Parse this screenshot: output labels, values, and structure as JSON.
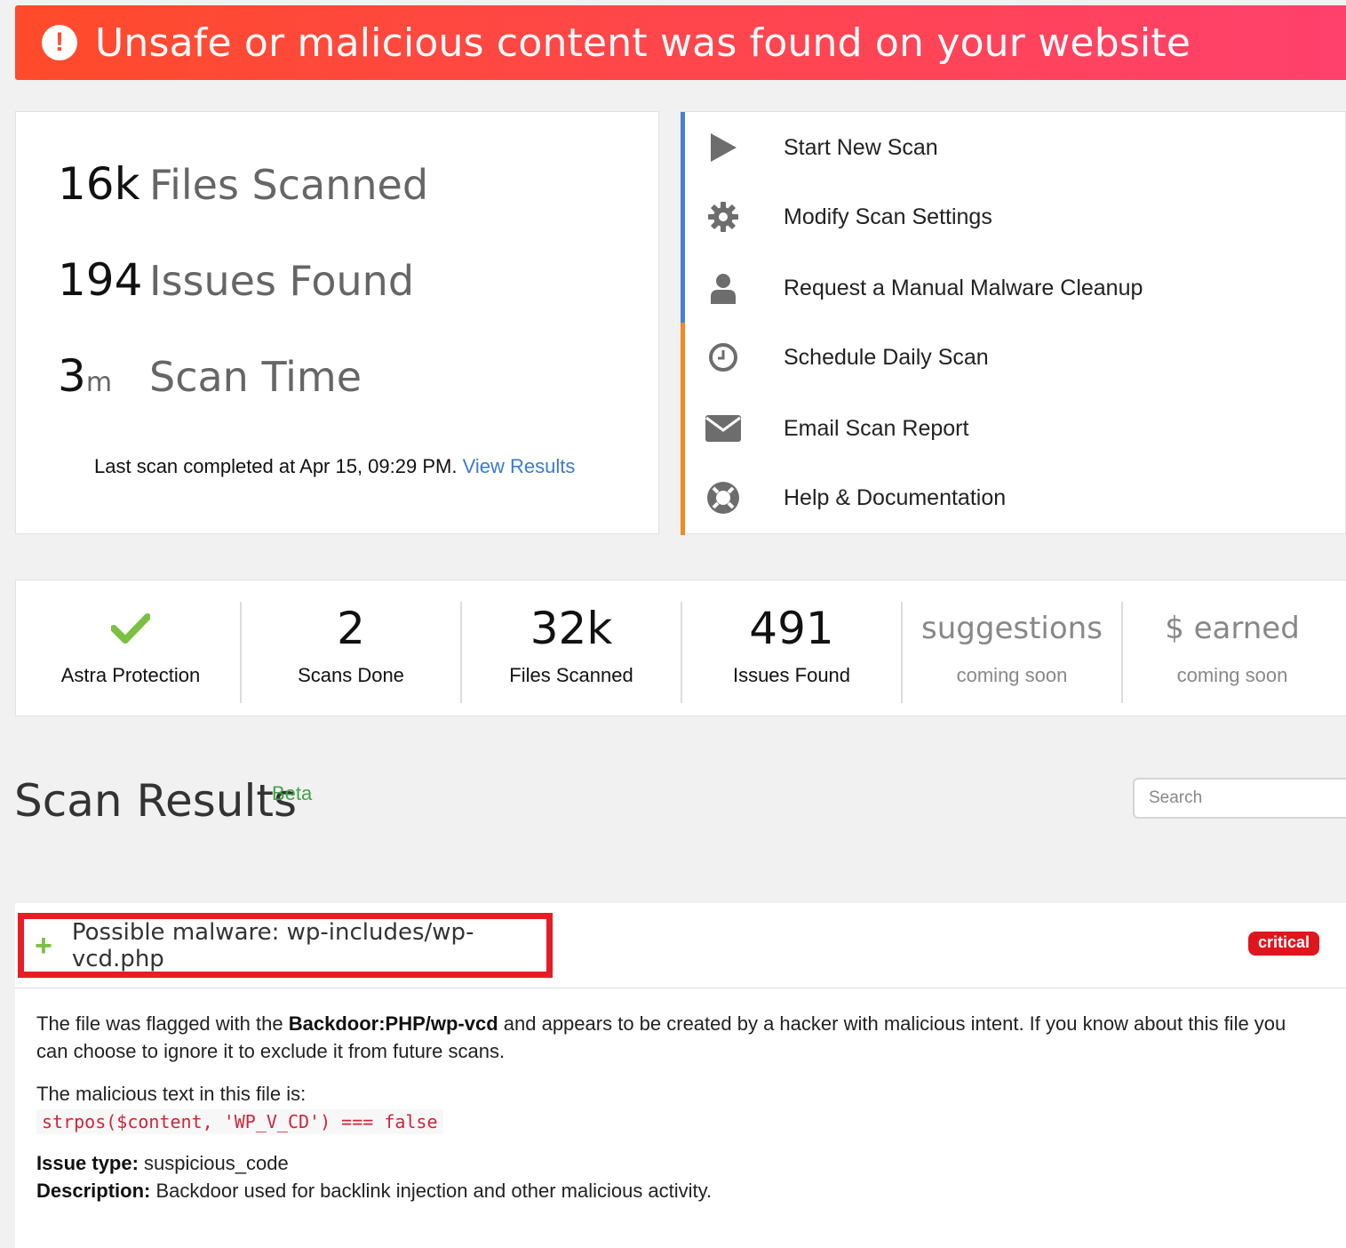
{
  "alert": {
    "icon": "exclamation-icon",
    "text": "Unsafe or malicious content was found on your website",
    "color": "#ff4a3a"
  },
  "stats": [
    {
      "value": "16k",
      "unit": "",
      "label": "Files Scanned"
    },
    {
      "value": "194",
      "unit": "",
      "label": "Issues Found"
    },
    {
      "value": "3",
      "unit": "m",
      "label": "Scan Time"
    }
  ],
  "last_scan": {
    "text": "Last scan completed at Apr 15, 09:29 PM.",
    "link": "View Results"
  },
  "actions": [
    {
      "icon": "play-icon",
      "label": "Start New Scan"
    },
    {
      "icon": "gear-icon",
      "label": "Modify Scan Settings"
    },
    {
      "icon": "user-icon",
      "label": "Request a Manual Malware Cleanup"
    },
    {
      "icon": "clock-icon",
      "label": "Schedule Daily Scan"
    },
    {
      "icon": "envelope-icon",
      "label": "Email Scan Report"
    },
    {
      "icon": "lifebuoy-icon",
      "label": "Help & Documentation"
    }
  ],
  "summary": [
    {
      "icon": "checkmark-icon",
      "label": "Astra Protection"
    },
    {
      "value": "2",
      "label": "Scans Done"
    },
    {
      "value": "32k",
      "label": "Files Scanned"
    },
    {
      "value": "491",
      "label": "Issues Found"
    },
    {
      "value": "suggestions",
      "label": "coming soon"
    },
    {
      "value": "$ earned",
      "label": "coming soon"
    }
  ],
  "results": {
    "title": "Scan Results",
    "beta": "Beta",
    "search_placeholder": "Search"
  },
  "issue": {
    "title": "Possible malware: wp-includes/wp-vcd.php",
    "severity": "critical",
    "desc_pre": "The file was flagged with the ",
    "desc_signature": "Backdoor:PHP/wp-vcd",
    "desc_post": " and appears to be created by a hacker with malicious intent. If you know about this file you can choose to ignore it to exclude it from future scans.",
    "malicious_label": "The malicious text in this file is:",
    "malicious_code": "strpos($content, 'WP_V_CD') === false",
    "type_label": "Issue type:",
    "type_value": " suspicious_code",
    "description_label": "Description:",
    "description_value": " Backdoor used for backlink injection and other malicious activity."
  }
}
